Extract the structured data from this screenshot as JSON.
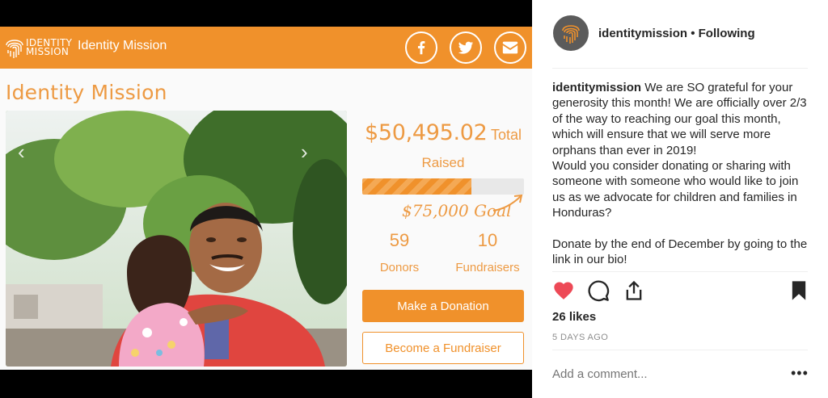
{
  "site": {
    "logo_line1": "IDENTITY",
    "logo_line2": "MISSION",
    "name": "Identity Mission",
    "social_icons": [
      "facebook-icon",
      "twitter-icon",
      "email-icon"
    ],
    "accent_color": "#f0912b"
  },
  "campaign": {
    "page_title": "Identity Mission",
    "amount_raised": "$50,495.02",
    "raised_label_part1": "Total",
    "raised_label_part2": "Raised",
    "progress_fraction": 0.673,
    "goal_text": "$75,000 Goal",
    "donors_count": "59",
    "donors_label": "Donors",
    "fundraisers_count": "10",
    "fundraisers_label": "Fundraisers",
    "donate_button": "Make a Donation",
    "fundraiser_button": "Become a Fundraiser"
  },
  "instagram": {
    "username": "identitymission",
    "separator": "•",
    "follow_status": "Following",
    "caption_author": "identitymission",
    "caption_text": "We are SO grateful for your generosity this month! We are officially over 2/3 of the way to reaching our goal this month, which will ensure that we will serve more orphans than ever in 2019!\nWould you consider donating or sharing with someone with someone who would like to join us as we advocate for children and families in Honduras?\n\nDonate by the end of December by going to the link in our bio!",
    "likes": "26 likes",
    "time_ago": "5 DAYS AGO",
    "comment_placeholder": "Add a comment...",
    "more_label": "•••",
    "like_color": "#ed4956"
  }
}
